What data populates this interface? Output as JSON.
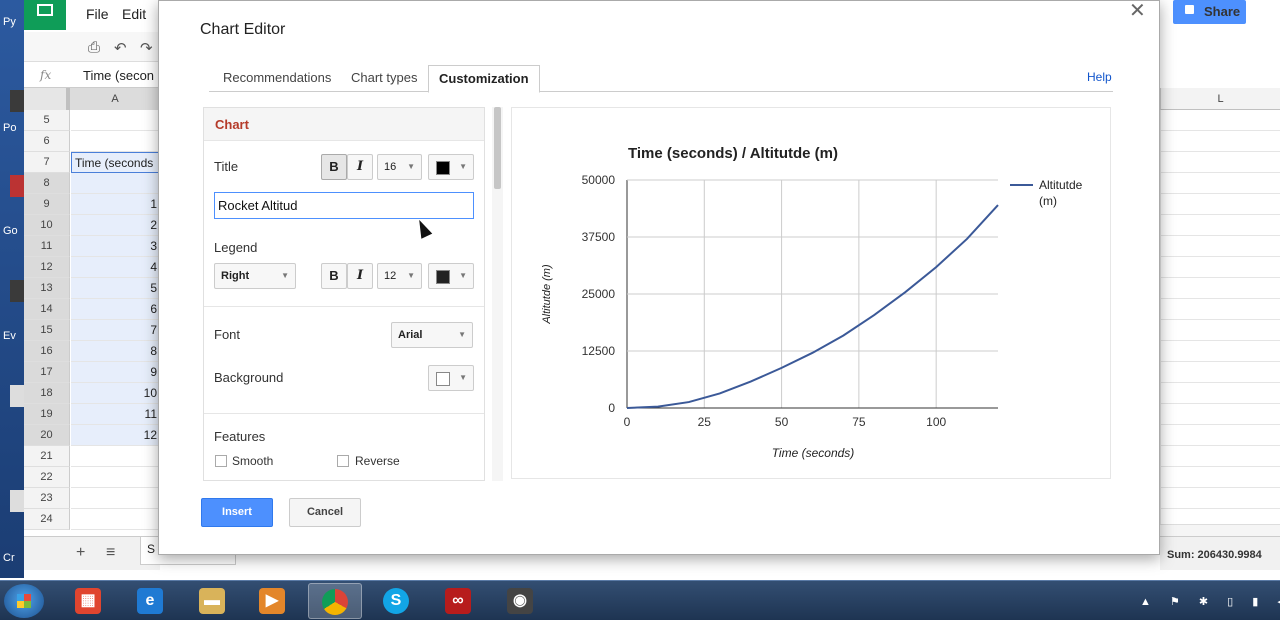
{
  "desktop": {
    "labels": [
      "Py",
      "Po",
      "Go",
      "Ev",
      "Cr"
    ]
  },
  "sheet": {
    "menu": [
      "File",
      "Edit"
    ],
    "formula_value": "Time (secon",
    "column_a": "A",
    "row_numbers": [
      "5",
      "6",
      "7",
      "8",
      "9",
      "10",
      "11",
      "12",
      "13",
      "14",
      "15",
      "16",
      "17",
      "18",
      "19",
      "20",
      "21",
      "22",
      "23",
      "24"
    ],
    "col_a_cells": [
      "",
      "",
      "Time (seconds",
      "",
      "1",
      "2",
      "3",
      "4",
      "5",
      "6",
      "7",
      "8",
      "9",
      "10",
      "11",
      "12",
      "",
      "",
      "",
      ""
    ],
    "sheet_tab_label": "S",
    "share_label": "Share",
    "right_column": "L",
    "sum_label": "Sum: 206430.9984"
  },
  "dialog": {
    "title": "Chart Editor",
    "tabs": [
      "Recommendations",
      "Chart types",
      "Customization"
    ],
    "active_tab": "Customization",
    "help": "Help",
    "section_header": "Chart",
    "title_label": "Title",
    "title_font_size": "16",
    "title_input_value": "Rocket Altitud",
    "legend_label": "Legend",
    "legend_position": "Right",
    "legend_font_size": "12",
    "font_label": "Font",
    "font_value": "Arial",
    "background_label": "Background",
    "features_label": "Features",
    "feature_smooth": "Smooth",
    "feature_reverse": "Reverse",
    "bold_glyph": "B",
    "italic_glyph": "I",
    "insert_label": "Insert",
    "cancel_label": "Cancel"
  },
  "chart_data": {
    "type": "line",
    "title": "Time (seconds) / Altitutde (m)",
    "xlabel": "Time (seconds)",
    "ylabel": "Altitutde (m)",
    "xlim": [
      0,
      120
    ],
    "ylim": [
      0,
      50000
    ],
    "x_ticks": [
      "0",
      "25",
      "50",
      "75",
      "100"
    ],
    "y_ticks": [
      "0",
      "12500",
      "25000",
      "37500",
      "50000"
    ],
    "grid": true,
    "legend_position": "right",
    "series": [
      {
        "name": "Altitutde (m)",
        "color": "#3b5998",
        "x": [
          0,
          10,
          20,
          30,
          40,
          50,
          60,
          70,
          80,
          90,
          100,
          110,
          120
        ],
        "y": [
          0,
          300,
          1300,
          3200,
          5800,
          8800,
          12100,
          15900,
          20400,
          25400,
          30900,
          37100,
          44500
        ]
      }
    ]
  }
}
